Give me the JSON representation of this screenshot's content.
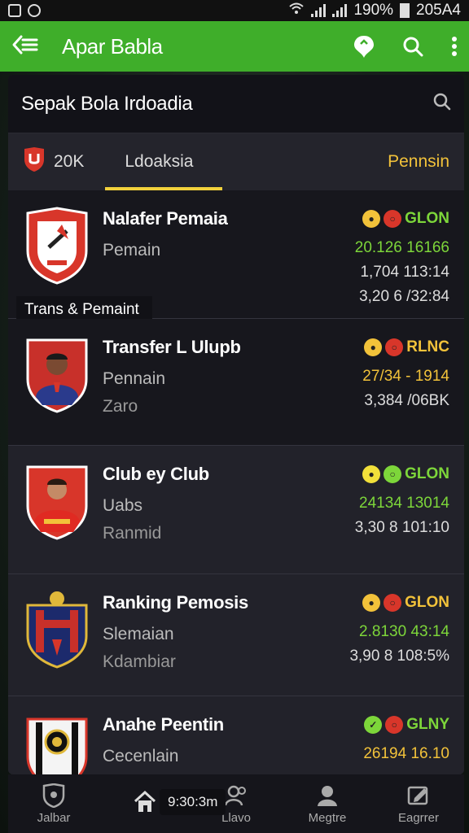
{
  "status_bar": {
    "battery": "190%",
    "time": "205A4"
  },
  "app_bar": {
    "title": "Apar Babla"
  },
  "search": {
    "title": "Sepak Bola Irdoadia"
  },
  "tabs": {
    "count": "20K",
    "middle": "Ldoaksia",
    "right": "Pennsin"
  },
  "overlay_label": "Trans & Pemaint",
  "rows": [
    {
      "title": "Nalafer Pemaia",
      "sub": "Pemain",
      "sub2": "",
      "badge_text": "GLON",
      "badge_color": "#7dd63a",
      "stat1": "20.126 16166",
      "stat1_color": "#7dd63a",
      "stat2": "1,704 113:14",
      "stat3": "3,20 6 /32:84"
    },
    {
      "title": "Transfer L Ulupb",
      "sub": "Pennain",
      "sub2": "Zaro",
      "badge_text": "RLNC",
      "badge_color": "#f2c23a",
      "stat1": "27/34 - 1914",
      "stat1_color": "#f2c23a",
      "stat2": "3,384 /06BK",
      "stat3": ""
    },
    {
      "title": "Club ey Club",
      "sub": "Uabs",
      "sub2": "Ranmid",
      "badge_text": "GLON",
      "badge_color": "#7dd63a",
      "stat1": "24134 13014",
      "stat1_color": "#7dd63a",
      "stat2": "3,30 8 101:10",
      "stat3": ""
    },
    {
      "title": "Ranking Pemosis",
      "sub": "Slemaian",
      "sub2": "Kdambiar",
      "badge_text": "GLON",
      "badge_color": "#f2c23a",
      "stat1": "2.8130 43:14",
      "stat1_color": "#7dd63a",
      "stat2": "3,90 8 108:5%",
      "stat3": ""
    },
    {
      "title": "Anahe Peentin",
      "sub": "Cecenlain",
      "sub2": "",
      "badge_text": "GLNY",
      "badge_color": "#7dd63a",
      "stat1": "26194 16.10",
      "stat1_color": "#f2c23a",
      "stat2": "",
      "stat3": ""
    }
  ],
  "bottom_nav": [
    {
      "label": "Jalbar",
      "icon": "shield-icon"
    },
    {
      "label": "",
      "icon": "home-icon"
    },
    {
      "label": "Llavo",
      "icon": "users-icon"
    },
    {
      "label": "Megtre",
      "icon": "profile-icon"
    },
    {
      "label": "Eagrrer",
      "icon": "edit-icon"
    }
  ],
  "bottom_time": "9:30:3m"
}
